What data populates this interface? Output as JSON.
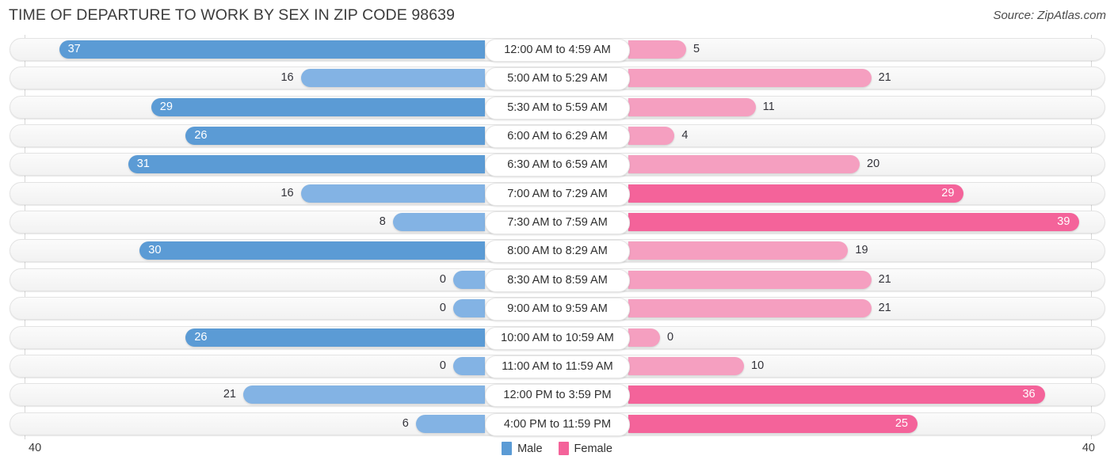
{
  "header": {
    "title": "TIME OF DEPARTURE TO WORK BY SEX IN ZIP CODE 98639",
    "source": "Source: ZipAtlas.com"
  },
  "legend": {
    "male_label": "Male",
    "female_label": "Female",
    "male_color": "#5b9bd5",
    "female_color": "#f4639a"
  },
  "axis": {
    "left_max": "40",
    "right_max": "40"
  },
  "chart_data": {
    "type": "bar",
    "title": "TIME OF DEPARTURE TO WORK BY SEX IN ZIP CODE 98639",
    "subtitle": "Source: ZipAtlas.com",
    "orientation": "horizontal-diverging",
    "xlabel": "",
    "ylabel": "",
    "xlim": [
      40,
      40
    ],
    "axis_max": 40,
    "grid": true,
    "legend_position": "bottom-center",
    "categories": [
      "12:00 AM to 4:59 AM",
      "5:00 AM to 5:29 AM",
      "5:30 AM to 5:59 AM",
      "6:00 AM to 6:29 AM",
      "6:30 AM to 6:59 AM",
      "7:00 AM to 7:29 AM",
      "7:30 AM to 7:59 AM",
      "8:00 AM to 8:29 AM",
      "8:30 AM to 8:59 AM",
      "9:00 AM to 9:59 AM",
      "10:00 AM to 10:59 AM",
      "11:00 AM to 11:59 AM",
      "12:00 PM to 3:59 PM",
      "4:00 PM to 11:59 PM"
    ],
    "series": [
      {
        "name": "Male",
        "color": "#5b9bd5",
        "values": [
          37,
          16,
          29,
          26,
          31,
          16,
          8,
          30,
          0,
          0,
          26,
          0,
          21,
          6
        ]
      },
      {
        "name": "Female",
        "color": "#f4639a",
        "values": [
          5,
          21,
          11,
          4,
          20,
          29,
          39,
          19,
          21,
          21,
          0,
          10,
          36,
          25
        ]
      }
    ]
  },
  "rows": [
    {
      "category": "12:00 AM to 4:59 AM",
      "male": "37",
      "female": "5"
    },
    {
      "category": "5:00 AM to 5:29 AM",
      "male": "16",
      "female": "21"
    },
    {
      "category": "5:30 AM to 5:59 AM",
      "male": "29",
      "female": "11"
    },
    {
      "category": "6:00 AM to 6:29 AM",
      "male": "26",
      "female": "4"
    },
    {
      "category": "6:30 AM to 6:59 AM",
      "male": "31",
      "female": "20"
    },
    {
      "category": "7:00 AM to 7:29 AM",
      "male": "16",
      "female": "29"
    },
    {
      "category": "7:30 AM to 7:59 AM",
      "male": "8",
      "female": "39"
    },
    {
      "category": "8:00 AM to 8:29 AM",
      "male": "30",
      "female": "19"
    },
    {
      "category": "8:30 AM to 8:59 AM",
      "male": "0",
      "female": "21"
    },
    {
      "category": "9:00 AM to 9:59 AM",
      "male": "0",
      "female": "21"
    },
    {
      "category": "10:00 AM to 10:59 AM",
      "male": "26",
      "female": "0"
    },
    {
      "category": "11:00 AM to 11:59 AM",
      "male": "0",
      "female": "10"
    },
    {
      "category": "12:00 PM to 3:59 PM",
      "male": "21",
      "female": "36"
    },
    {
      "category": "4:00 PM to 11:59 PM",
      "male": "6",
      "female": "25"
    }
  ]
}
